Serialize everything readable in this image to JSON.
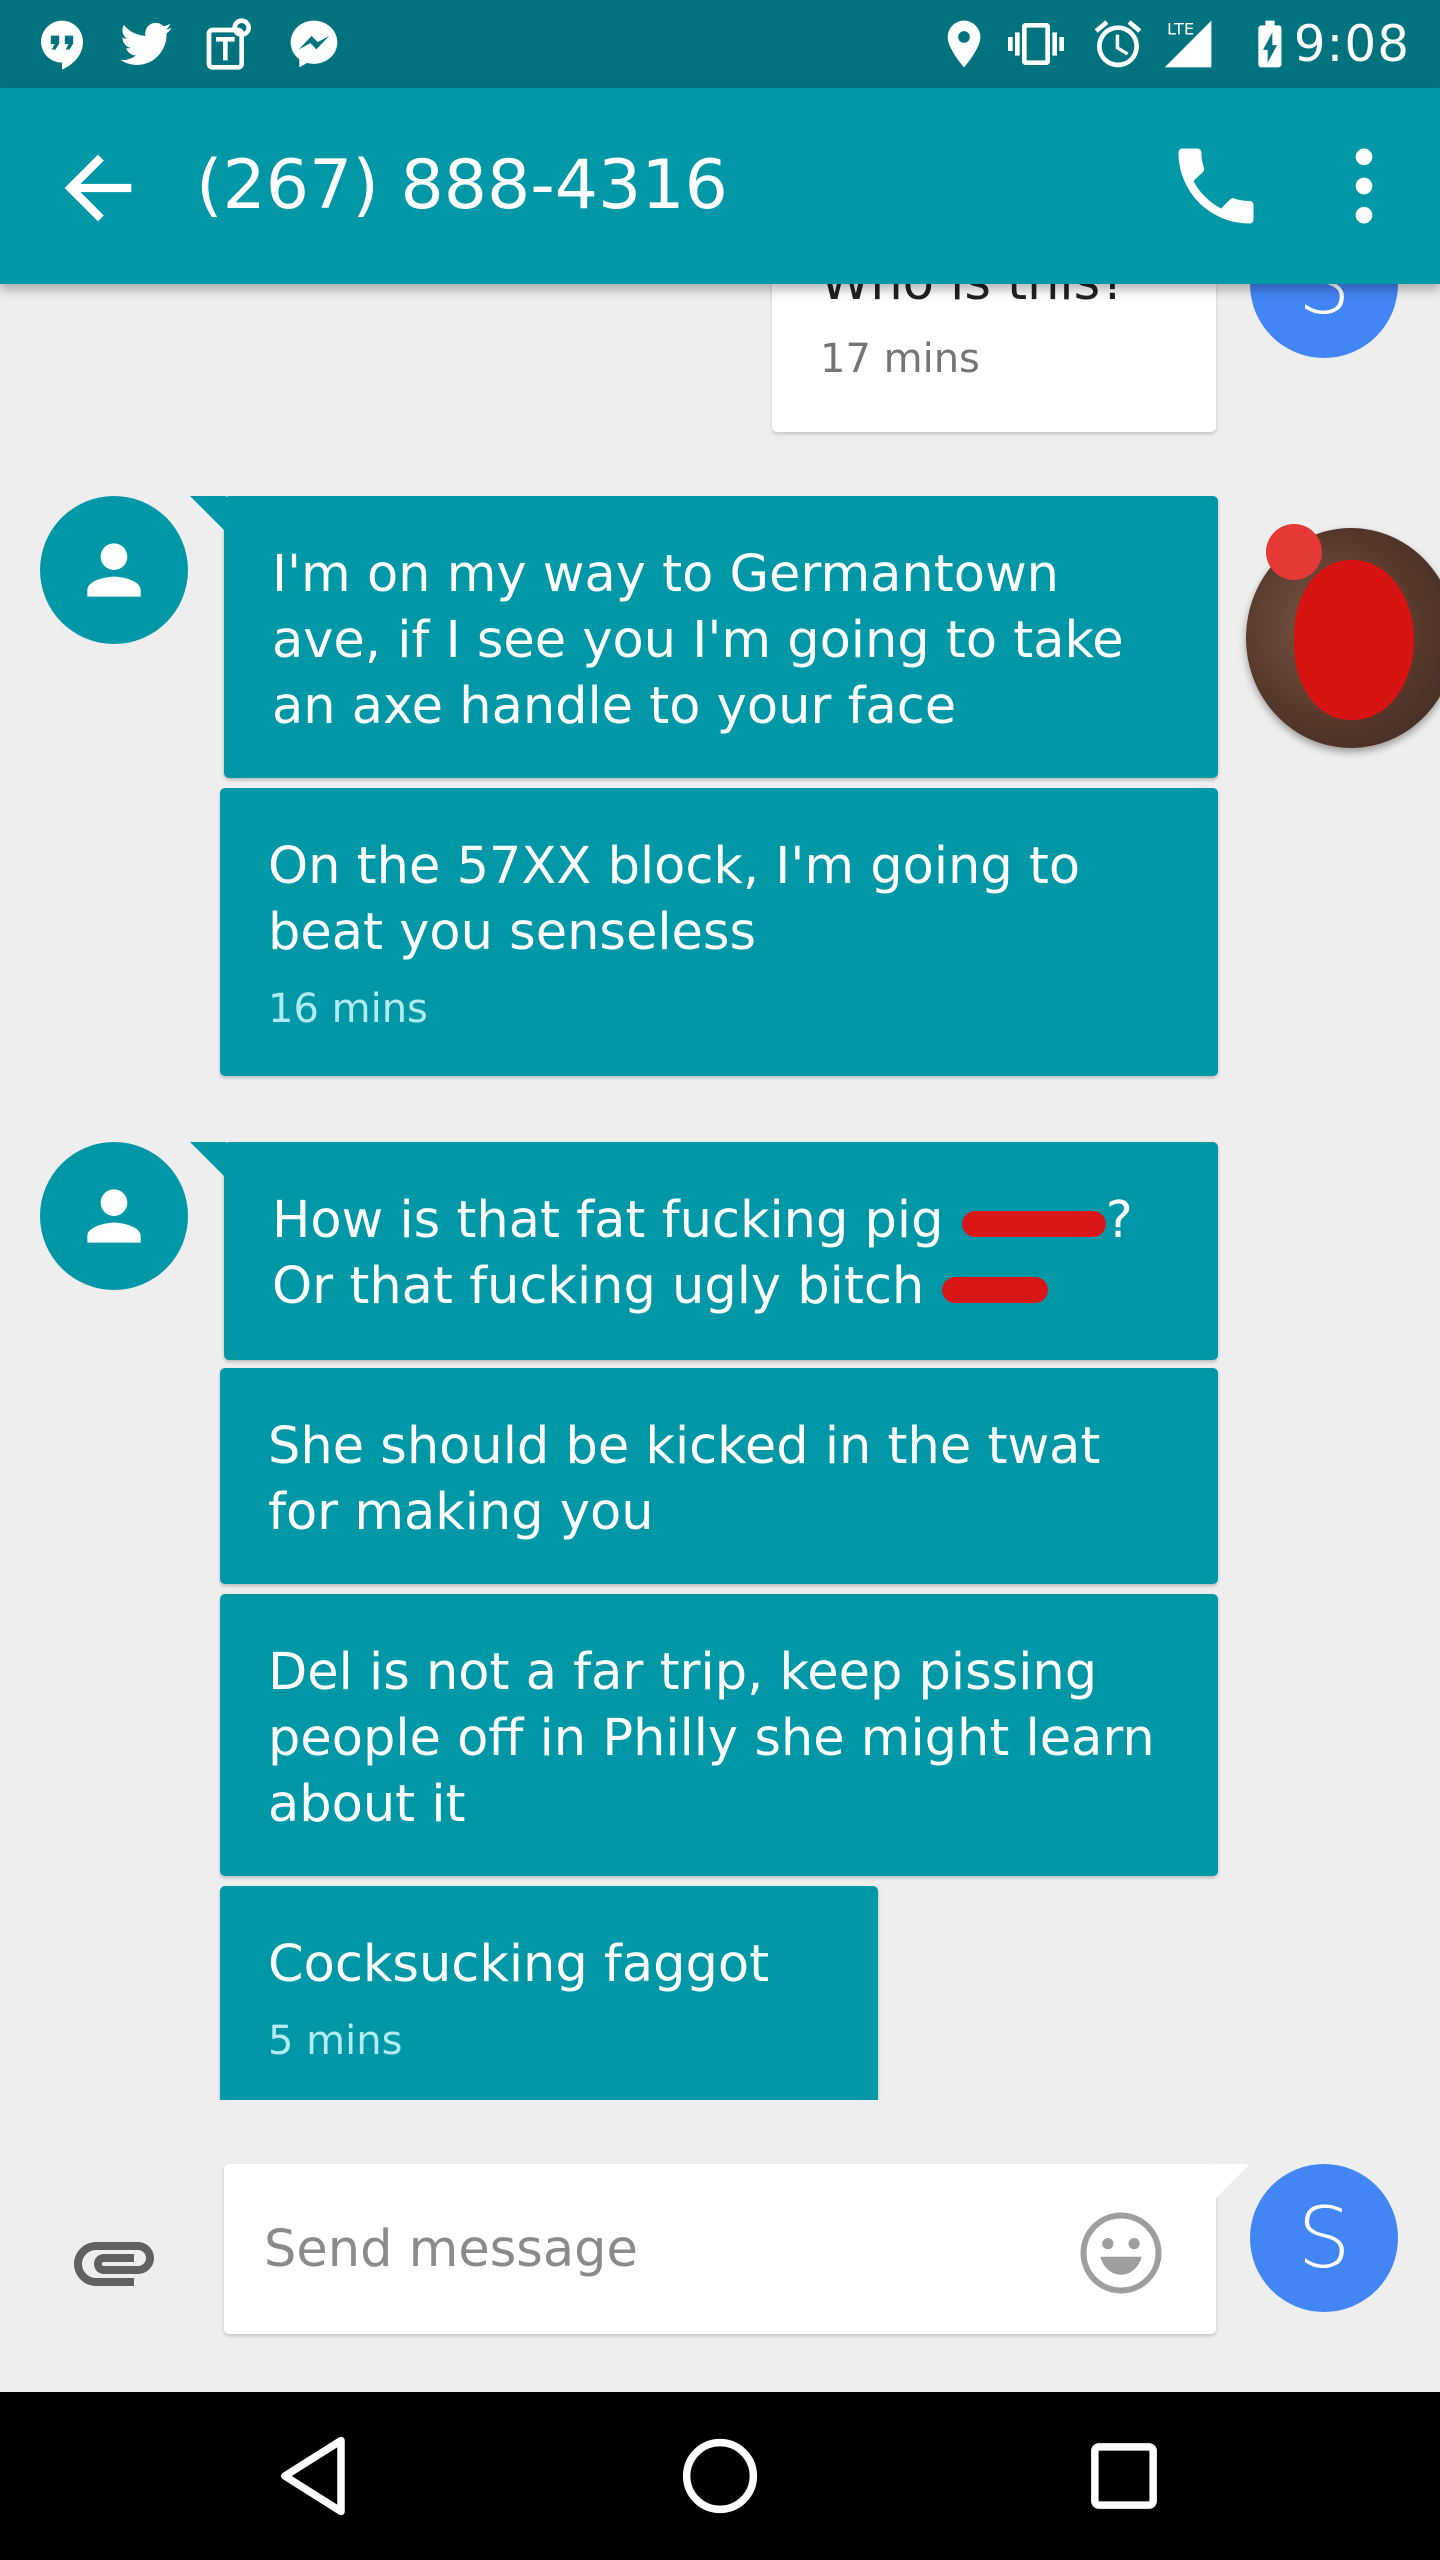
{
  "status_bar": {
    "time": "9:08",
    "network_label": "LTE",
    "notification_icons": [
      "hangouts-icon",
      "twitter-icon",
      "tmobile-icon",
      "messenger-icon"
    ],
    "system_icons": [
      "location-icon",
      "vibrate-icon",
      "alarm-icon",
      "lte-signal-icon",
      "battery-charging-icon"
    ]
  },
  "app_bar": {
    "title": "(267) 888-4316",
    "back_icon": "arrow-back-icon",
    "call_icon": "phone-icon",
    "more_icon": "more-vert-icon"
  },
  "self_avatar_letter": "S",
  "messages": {
    "outgoing_1": {
      "text": "Who is this?",
      "time": "17 mins"
    },
    "group_1": [
      {
        "text": "I'm on my way to Germantown ave, if I see you I'm going to take an axe handle to your face"
      },
      {
        "text": "On the 57XX block, I'm going to beat you senseless",
        "time": "16 mins"
      }
    ],
    "group_2": [
      {
        "line1": "How is that fat fucking pig",
        "line1_end": "?",
        "line2": "Or that fucking ugly bitch"
      },
      {
        "text": "She should be kicked in the twat for making you"
      },
      {
        "text": "Del is not a far trip, keep pissing people off in Philly she might learn about it"
      },
      {
        "text": "Cocksucking faggot",
        "time": "5 mins"
      }
    ]
  },
  "compose": {
    "placeholder": "Send message",
    "attach_icon": "attach-icon",
    "emoji_icon": "emoji-icon"
  },
  "nav_bar": {
    "icons": [
      "nav-back-icon",
      "nav-home-icon",
      "nav-recents-icon"
    ]
  },
  "colors": {
    "status_bar": "#00737f",
    "app_bar": "#0097a7",
    "incoming_bubble": "#0097a7",
    "self_avatar": "#4285f4",
    "background": "#eeeeee",
    "redaction": "#d81313"
  }
}
